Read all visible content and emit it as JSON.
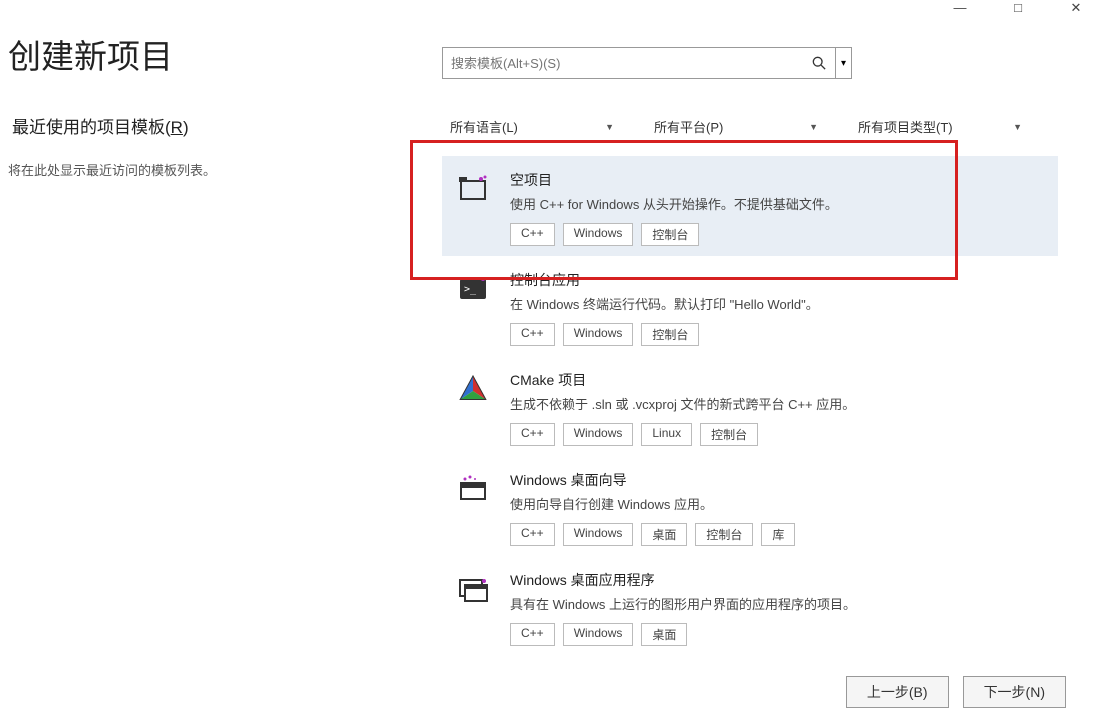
{
  "window": {
    "minimize": "—",
    "maximize": "□",
    "close": "✕"
  },
  "header": {
    "title": "创建新项目"
  },
  "recent": {
    "title_prefix": "最近使用的项目模板(",
    "title_key": "R",
    "title_suffix": ")",
    "empty": "将在此处显示最近访问的模板列表。"
  },
  "search": {
    "placeholder": "搜索模板(Alt+S)(S)"
  },
  "filters": {
    "language": "所有语言(L)",
    "platform": "所有平台(P)",
    "type": "所有项目类型(T)"
  },
  "templates": [
    {
      "name": "空项目",
      "desc": "使用 C++ for Windows 从头开始操作。不提供基础文件。",
      "tags": [
        "C++",
        "Windows",
        "控制台"
      ],
      "selected": true
    },
    {
      "name": "控制台应用",
      "desc": "在 Windows 终端运行代码。默认打印 \"Hello World\"。",
      "tags": [
        "C++",
        "Windows",
        "控制台"
      ]
    },
    {
      "name": "CMake 项目",
      "desc": "生成不依赖于 .sln 或 .vcxproj 文件的新式跨平台 C++ 应用。",
      "tags": [
        "C++",
        "Windows",
        "Linux",
        "控制台"
      ]
    },
    {
      "name": "Windows 桌面向导",
      "desc": "使用向导自行创建 Windows 应用。",
      "tags": [
        "C++",
        "Windows",
        "桌面",
        "控制台",
        "库"
      ]
    },
    {
      "name": "Windows 桌面应用程序",
      "desc": "具有在 Windows 上运行的图形用户界面的应用程序的项目。",
      "tags": [
        "C++",
        "Windows",
        "桌面"
      ]
    }
  ],
  "footer": {
    "back": "上一步(B)",
    "next": "下一步(N)"
  }
}
